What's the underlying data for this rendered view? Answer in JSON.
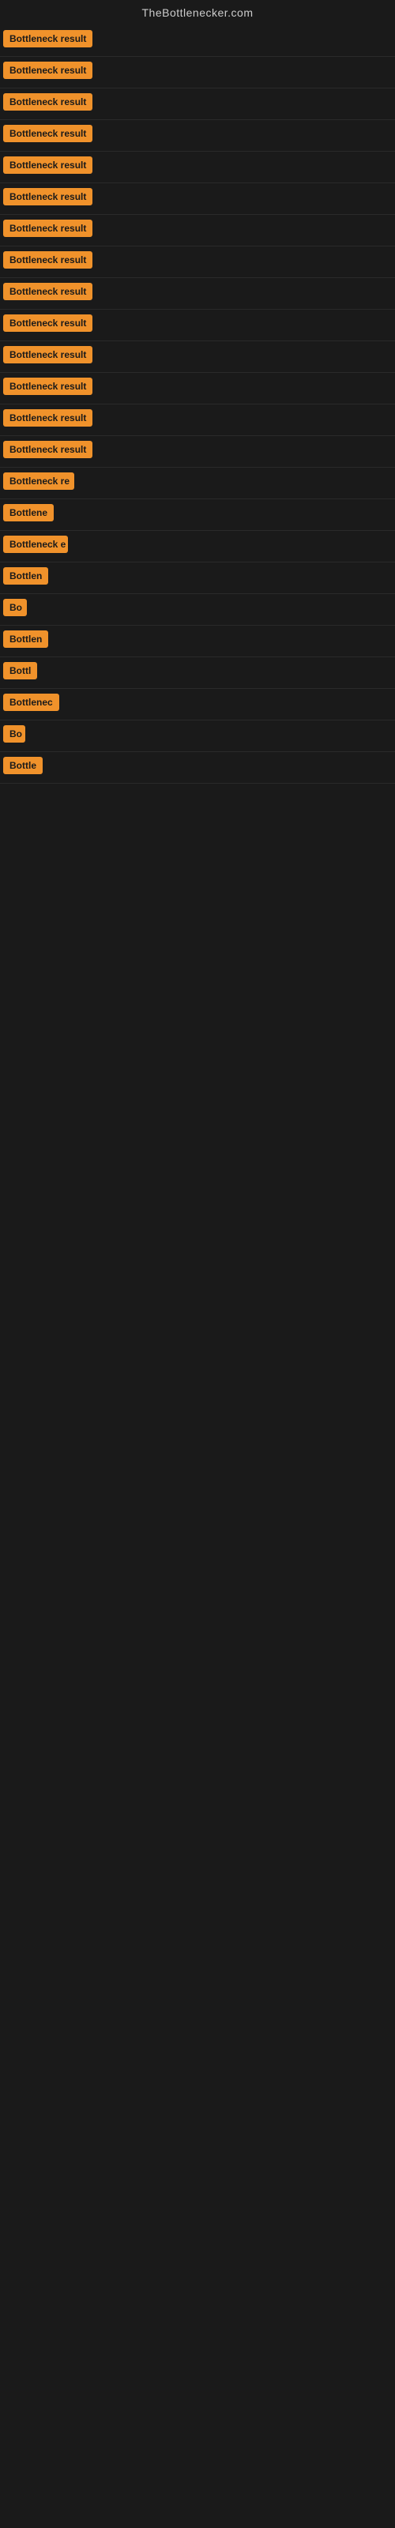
{
  "site": {
    "title": "TheBottlenecker.com"
  },
  "rows": [
    {
      "id": 1,
      "label": "Bottleneck result",
      "width": 120
    },
    {
      "id": 2,
      "label": "Bottleneck result",
      "width": 120
    },
    {
      "id": 3,
      "label": "Bottleneck result",
      "width": 120
    },
    {
      "id": 4,
      "label": "Bottleneck result",
      "width": 120
    },
    {
      "id": 5,
      "label": "Bottleneck result",
      "width": 120
    },
    {
      "id": 6,
      "label": "Bottleneck result",
      "width": 120
    },
    {
      "id": 7,
      "label": "Bottleneck result",
      "width": 120
    },
    {
      "id": 8,
      "label": "Bottleneck result",
      "width": 120
    },
    {
      "id": 9,
      "label": "Bottleneck result",
      "width": 120
    },
    {
      "id": 10,
      "label": "Bottleneck result",
      "width": 120
    },
    {
      "id": 11,
      "label": "Bottleneck result",
      "width": 120
    },
    {
      "id": 12,
      "label": "Bottleneck result",
      "width": 120
    },
    {
      "id": 13,
      "label": "Bottleneck result",
      "width": 120
    },
    {
      "id": 14,
      "label": "Bottleneck result",
      "width": 120
    },
    {
      "id": 15,
      "label": "Bottleneck re",
      "width": 90
    },
    {
      "id": 16,
      "label": "Bottlene",
      "width": 72
    },
    {
      "id": 17,
      "label": "Bottleneck e",
      "width": 82
    },
    {
      "id": 18,
      "label": "Bottlen",
      "width": 65
    },
    {
      "id": 19,
      "label": "Bo",
      "width": 30
    },
    {
      "id": 20,
      "label": "Bottlen",
      "width": 65
    },
    {
      "id": 21,
      "label": "Bottl",
      "width": 48
    },
    {
      "id": 22,
      "label": "Bottlenec",
      "width": 76
    },
    {
      "id": 23,
      "label": "Bo",
      "width": 28
    },
    {
      "id": 24,
      "label": "Bottle",
      "width": 52
    }
  ],
  "accent_color": "#f0922b"
}
